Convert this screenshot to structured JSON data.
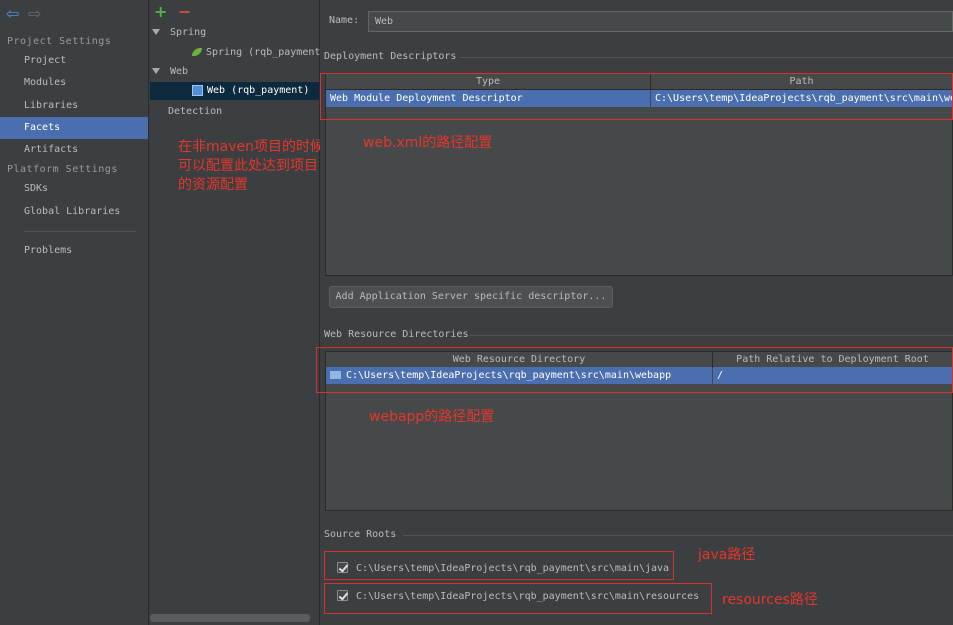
{
  "nav": {
    "back_icon": "arrow-left-icon",
    "forward_icon": "arrow-right-icon",
    "project_settings_header": "Project Settings",
    "project_items": [
      "Project",
      "Modules",
      "Libraries",
      "Facets",
      "Artifacts"
    ],
    "platform_settings_header": "Platform Settings",
    "platform_items": [
      "SDKs",
      "Global Libraries"
    ],
    "problems": "Problems",
    "selected": "Facets"
  },
  "toolbar": {
    "add_symbol": "+",
    "remove_symbol": "−"
  },
  "tree": {
    "spring_group": "Spring",
    "spring_child": "Spring (rqb_payment",
    "web_group": "Web",
    "web_child": "Web (rqb_payment)",
    "detection": "Detection"
  },
  "form": {
    "name_label": "Name:",
    "name_value": "Web"
  },
  "deployment": {
    "title": "Deployment Descriptors",
    "col_type": "Type",
    "col_path": "Path",
    "rows": [
      {
        "type": "Web Module Deployment Descriptor",
        "path": "C:\\Users\\temp\\IdeaProjects\\rqb_payment\\src\\main\\web"
      }
    ],
    "add_button": "Add Application Server specific descriptor..."
  },
  "web_resources": {
    "title": "Web Resource Directories",
    "col_dir": "Web Resource Directory",
    "col_rel": "Path Relative to Deployment Root",
    "rows": [
      {
        "dir": "C:\\Users\\temp\\IdeaProjects\\rqb_payment\\src\\main\\webapp",
        "rel": "/"
      }
    ]
  },
  "source_roots": {
    "title": "Source Roots",
    "items": [
      {
        "path": "C:\\Users\\temp\\IdeaProjects\\rqb_payment\\src\\main\\java",
        "checked": true
      },
      {
        "path": "C:\\Users\\temp\\IdeaProjects\\rqb_payment\\src\\main\\resources",
        "checked": true
      }
    ]
  },
  "annotations": {
    "non_maven_note_line1": "在非maven项目的时候",
    "non_maven_note_line2": "可以配置此处达到项目",
    "non_maven_note_line3": "的资源配置",
    "webxml_note": "web.xml的路径配置",
    "webapp_note": "webapp的路径配置",
    "java_note": "java路径",
    "resources_note": "resources路径"
  },
  "colors": {
    "background": "#3c3f41",
    "selection": "#4b6eaf",
    "annotation_red": "#e8352a",
    "add_green": "#4fb346",
    "remove_red": "#d94a38"
  }
}
